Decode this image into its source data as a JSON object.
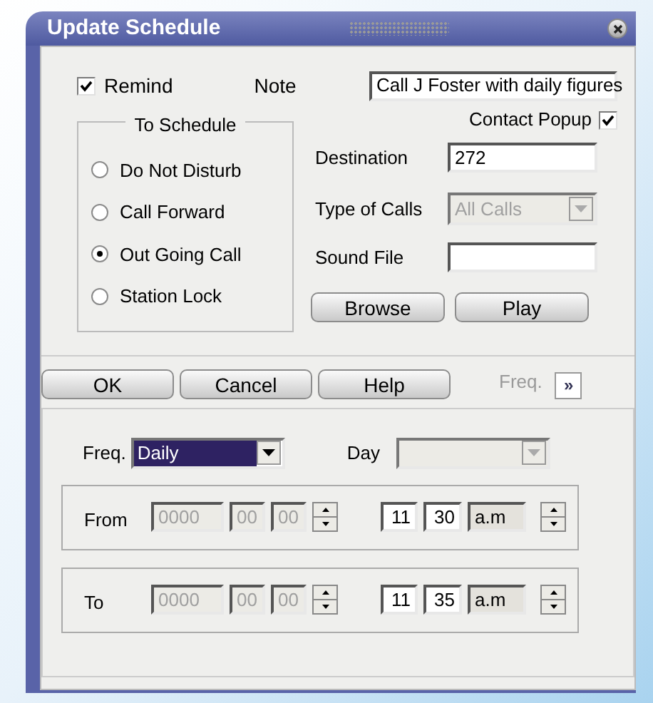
{
  "window": {
    "title": "Update Schedule"
  },
  "remind": {
    "label": "Remind",
    "checked": true
  },
  "note": {
    "label": "Note",
    "value": "Call J Foster with daily figures"
  },
  "to_schedule": {
    "title": "To Schedule",
    "options": [
      {
        "label": "Do Not Disturb",
        "selected": false
      },
      {
        "label": "Call Forward",
        "selected": false
      },
      {
        "label": "Out Going Call",
        "selected": true
      },
      {
        "label": "Station Lock",
        "selected": false
      }
    ]
  },
  "contact_popup": {
    "label": "Contact Popup",
    "checked": true
  },
  "destination": {
    "label": "Destination",
    "value": "272"
  },
  "type_of_calls": {
    "label": "Type of Calls",
    "value": "All Calls",
    "disabled": true
  },
  "sound_file": {
    "label": "Sound File"
  },
  "file_buttons": [
    "Browse",
    "Play"
  ],
  "dialog_buttons": [
    "OK",
    "Cancel",
    "Help"
  ],
  "freq_toggle": {
    "label": "Freq.",
    "button": "»"
  },
  "freq": {
    "label": "Freq.",
    "value": "Daily"
  },
  "day": {
    "label": "Day",
    "disabled": true
  },
  "ranges": [
    {
      "label": "From",
      "date": [
        "0000",
        "00",
        "00"
      ],
      "date_disabled": true,
      "hour": "11",
      "minute": "30",
      "ampm": "a.m"
    },
    {
      "label": "To",
      "date": [
        "0000",
        "00",
        "00"
      ],
      "date_disabled": true,
      "hour": "11",
      "minute": "35",
      "ampm": "a.m"
    }
  ]
}
